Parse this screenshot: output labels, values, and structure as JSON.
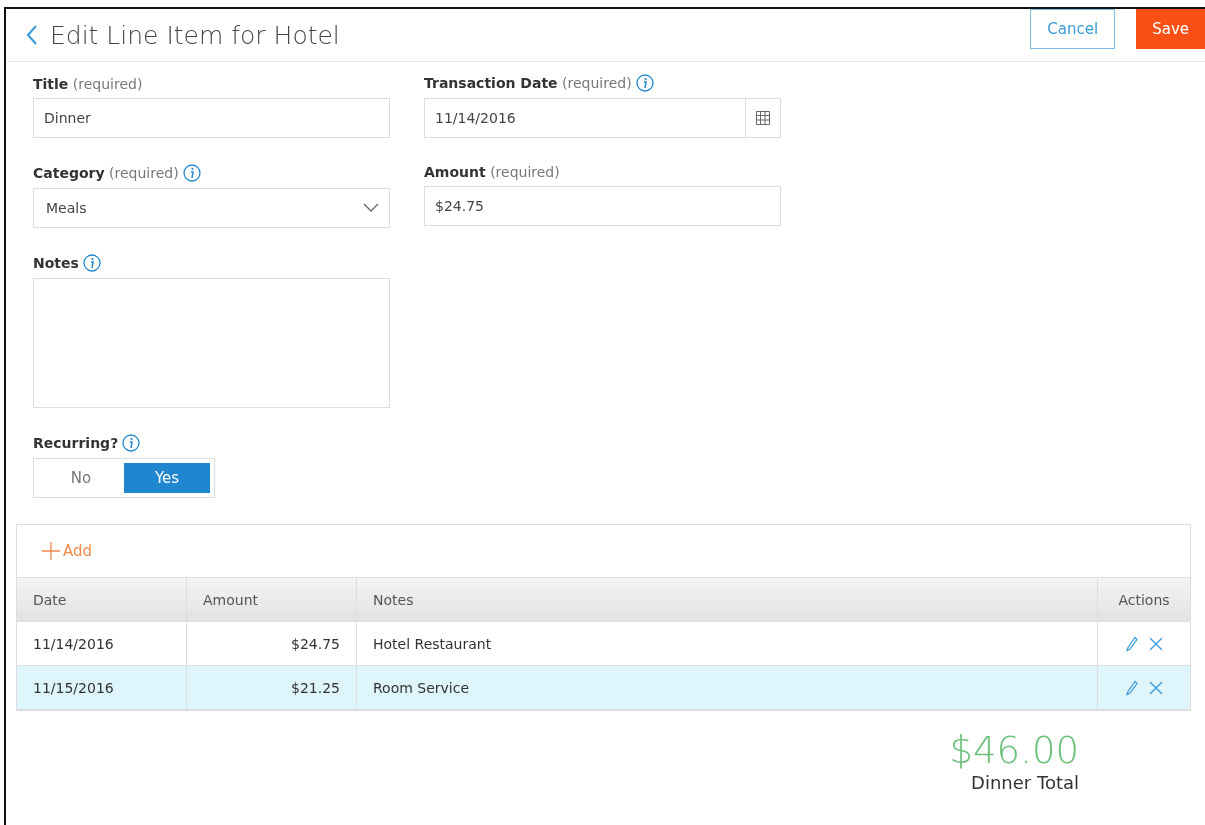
{
  "header": {
    "title": "Edit Line Item for Hotel",
    "buttons": [
      {
        "kind": "secondary",
        "label": "Cancel"
      },
      {
        "kind": "primary",
        "label": "Save"
      }
    ]
  },
  "form": {
    "title": {
      "label": "Title",
      "hint": "(required)",
      "value": "Dinner"
    },
    "transaction_date": {
      "label": "Transaction Date",
      "hint": "(required)",
      "value": "11/14/2016"
    },
    "category": {
      "label": "Category",
      "hint": "(required)",
      "value": "Meals"
    },
    "amount": {
      "label": "Amount",
      "hint": "(required)",
      "value": "$24.75"
    },
    "notes": {
      "label": "Notes"
    },
    "recurring": {
      "label": "Recurring?",
      "options": [
        {
          "label": "No",
          "selected": false
        },
        {
          "label": "Yes",
          "selected": true
        }
      ]
    }
  },
  "table": {
    "add_label": "Add",
    "columns": [
      "Date",
      "Amount",
      "Notes",
      "Actions"
    ],
    "rows": [
      {
        "date": "11/14/2016",
        "amount": "$24.75",
        "notes": "Hotel Restaurant",
        "selected": false
      },
      {
        "date": "11/15/2016",
        "amount": "$21.25",
        "notes": "Room Service",
        "selected": true
      }
    ]
  },
  "total": {
    "value": "$46.00",
    "label": "Dinner Total"
  }
}
